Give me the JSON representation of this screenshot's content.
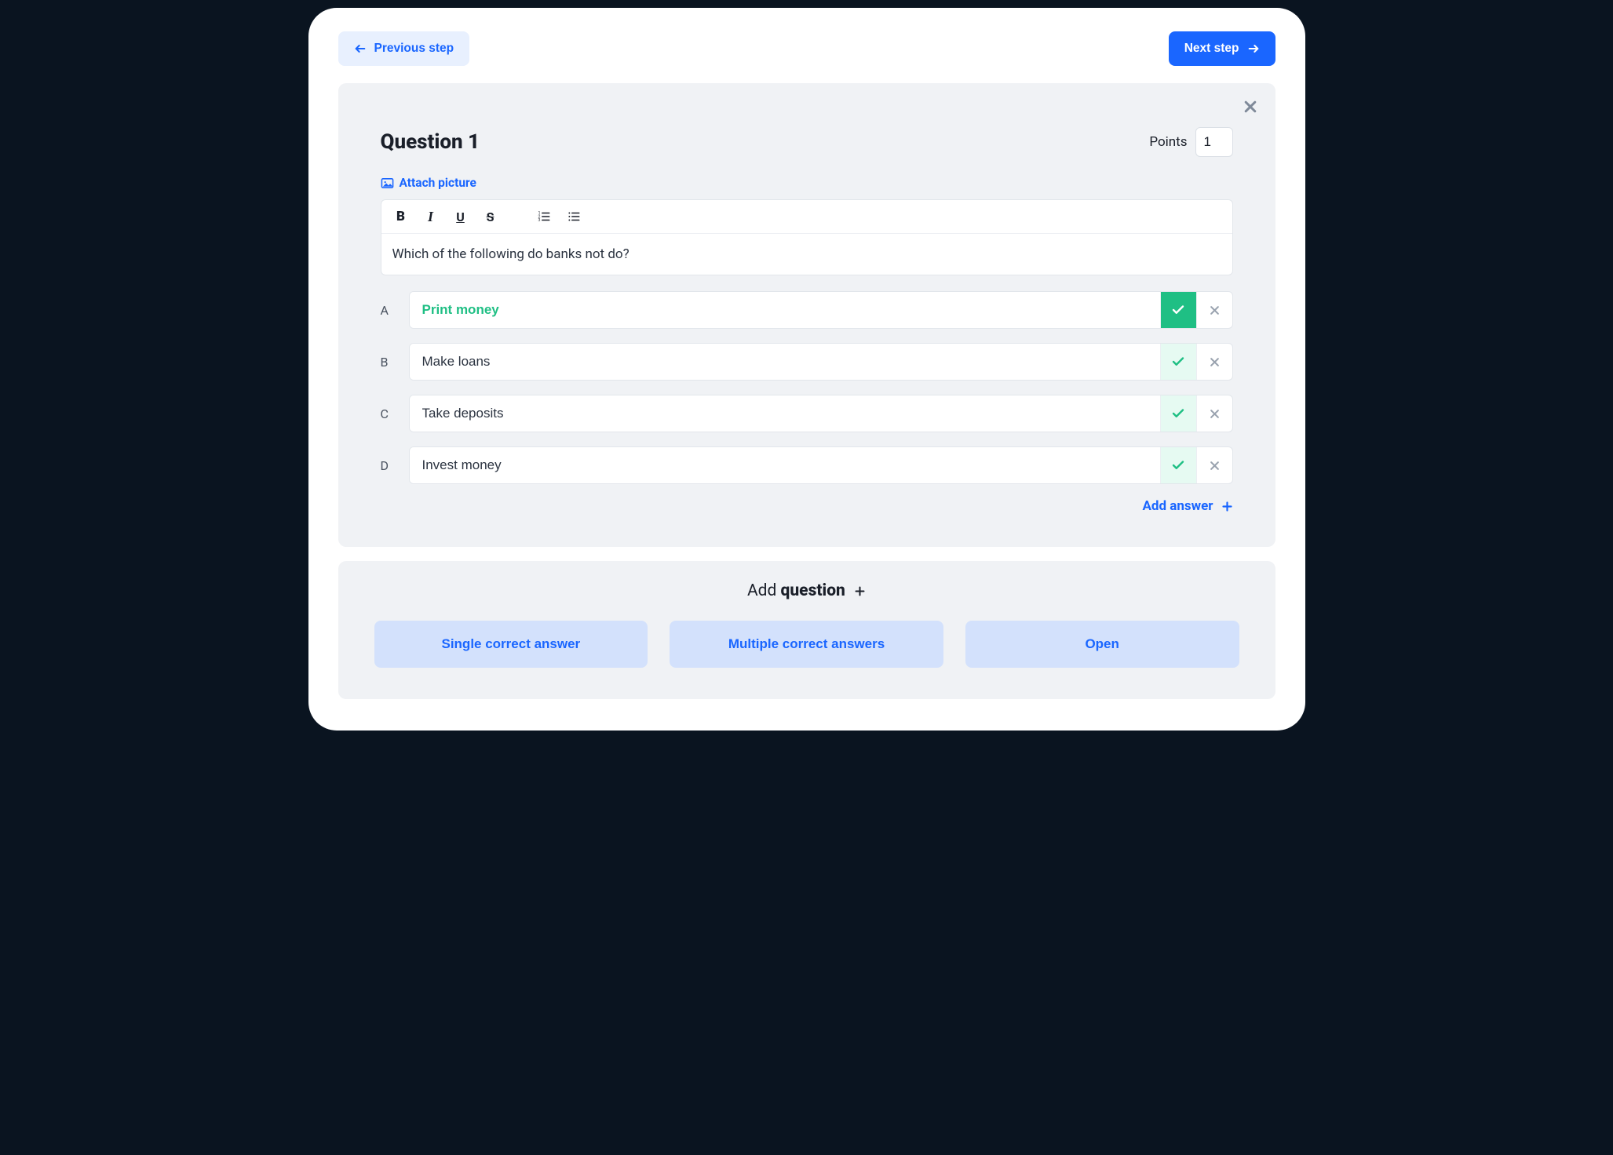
{
  "nav": {
    "prev_label": "Previous step",
    "next_label": "Next step"
  },
  "question": {
    "title": "Question 1",
    "points_label": "Points",
    "points_value": "1",
    "attach_label": "Attach picture",
    "body": "Which of the following do banks not do?",
    "answers": [
      {
        "letter": "A",
        "text": "Print money",
        "correct": true
      },
      {
        "letter": "B",
        "text": "Make loans",
        "correct": false
      },
      {
        "letter": "C",
        "text": "Take deposits",
        "correct": false
      },
      {
        "letter": "D",
        "text": "Invest money",
        "correct": false
      }
    ],
    "add_answer_label": "Add answer"
  },
  "add_question": {
    "prefix": "Add ",
    "bold": "question",
    "types": [
      "Single correct answer",
      "Multiple correct answers",
      "Open"
    ]
  }
}
